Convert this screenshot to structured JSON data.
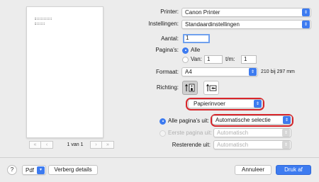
{
  "preview": {
    "prev_icon": "chevron-double-left-icon",
    "back_icon": "chevron-left-icon",
    "page_label": "1 van 1",
    "forward_icon": "chevron-right-icon",
    "next_icon": "chevron-double-right-icon"
  },
  "printer": {
    "label": "Printer:",
    "value": "Canon Printer"
  },
  "settings": {
    "label": "Instellingen:",
    "value": "Standaardinstellingen"
  },
  "copies": {
    "label": "Aantal:",
    "value": "1"
  },
  "pages": {
    "label": "Pagina's:",
    "all_label": "Alle",
    "from_label": "Van:",
    "from_value": "1",
    "to_label": "t/m:",
    "to_value": "1"
  },
  "format": {
    "label": "Formaat:",
    "value": "A4",
    "dimensions": "210 bij 297 mm"
  },
  "orientation": {
    "label": "Richting:",
    "portrait_icon": "portrait-orientation-icon",
    "landscape_icon": "landscape-orientation-icon"
  },
  "section_popup": {
    "value": "Papierinvoer"
  },
  "paper_feed": {
    "all_pages_label": "Alle pagina's uit:",
    "all_pages_value": "Automatische selectie",
    "first_page_label": "Eerste pagina uit:",
    "first_page_value": "Automatisch",
    "remaining_label": "Resterende uit:",
    "remaining_value": "Automatisch"
  },
  "footer": {
    "help_label": "?",
    "pdf_label": "Pdf",
    "hide_details_label": "Verberg details",
    "cancel_label": "Annuleer",
    "print_label": "Druk af"
  },
  "colors": {
    "accent": "#3d7bf0",
    "highlight": "#d9262b"
  }
}
